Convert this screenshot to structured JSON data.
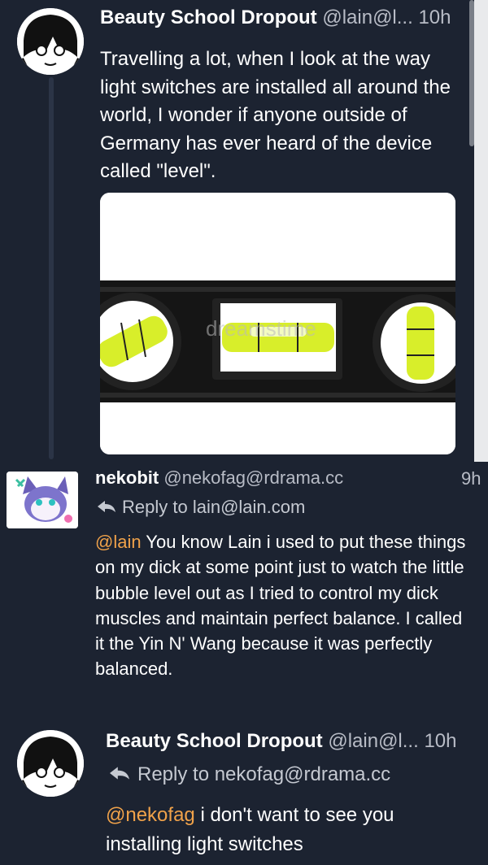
{
  "posts": [
    {
      "display_name": "Beauty School Dropout",
      "handle": "@lain@l...",
      "time": "10h",
      "text": "Travelling a lot, when I look at the way light switches are installed all around the world, I wonder if anyone outside of Germany has ever heard of the device called \"level\".",
      "image_watermark": "dreamstime"
    },
    {
      "display_name": "nekobit",
      "handle": "@nekofag@rdrama.cc",
      "time": "9h",
      "reply_to": "Reply to lain@lain.com",
      "mention": "@lain",
      "text": " You know Lain i used to put these things on my dick at some point just to watch the little bubble level out as I tried to control my dick muscles and maintain perfect balance. I called it the Yin N' Wang because it was perfectly balanced."
    },
    {
      "display_name": "Beauty School Dropout",
      "handle": "@lain@l...",
      "time": "10h",
      "reply_to": "Reply to nekofag@rdrama.cc",
      "mention": "@nekofag",
      "text": " i don't want to see you installing light switches"
    }
  ],
  "icons": {
    "reply": "reply-arrow-icon"
  },
  "colors": {
    "background": "#1c2331",
    "mention": "#f0a24a",
    "muted": "#b8bcc6"
  }
}
